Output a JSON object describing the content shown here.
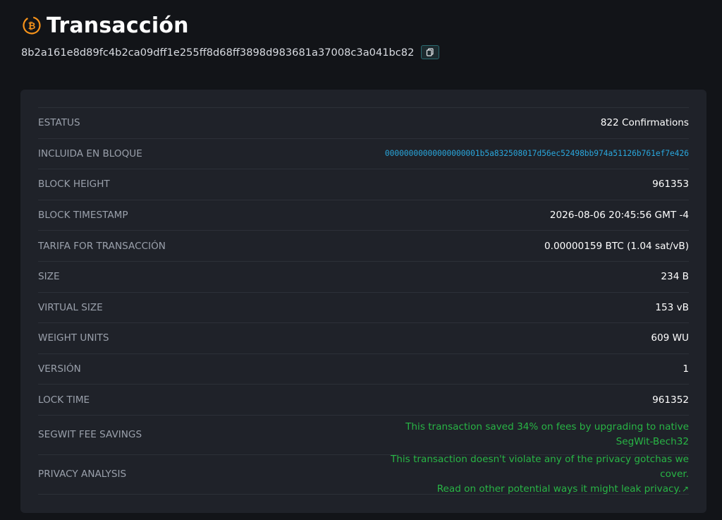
{
  "header": {
    "title": "Transacción",
    "txid": "8b2a161e8d89fc4b2ca09dff1e255ff8d68ff3898d983681a37008c3a041bc82"
  },
  "colors": {
    "background": "#121418",
    "card": "#1f2229",
    "bitcoin_orange": "#f7931a",
    "link_blue": "#2aa7dd",
    "green_text": "#28b545"
  },
  "icons": {
    "title": "bitcoin-icon",
    "copy": "copy-icon",
    "external": "external-link-icon"
  },
  "details": {
    "status": {
      "label": "ESTATUS",
      "value": "822 Confirmations"
    },
    "block": {
      "label": "INCLUIDA EN BLOQUE",
      "value": "00000000000000000001b5a832508017d56ec52498bb974a51126b761ef7e426"
    },
    "height": {
      "label": "BLOCK HEIGHT",
      "value": "961353"
    },
    "timestamp": {
      "label": "BLOCK TIMESTAMP",
      "value": "2026-08-06 20:45:56 GMT -4"
    },
    "fee": {
      "label": "TARIFA FOR TRANSACCIÓN",
      "value": "0.00000159 BTC (1.04 sat/vB)"
    },
    "size": {
      "label": "SIZE",
      "value": "234 B"
    },
    "vsize": {
      "label": "VIRTUAL SIZE",
      "value": "153 vB"
    },
    "weight": {
      "label": "WEIGHT UNITS",
      "value": "609 WU"
    },
    "version": {
      "label": "VERSIÓN",
      "value": "1"
    },
    "locktime": {
      "label": "LOCK TIME",
      "value": "961352"
    },
    "segwit": {
      "label": "SEGWIT FEE SAVINGS",
      "value": "This transaction saved 34% on fees by upgrading to native SegWit-Bech32"
    },
    "privacy": {
      "label": "PRIVACY ANALYSIS",
      "line1": "This transaction doesn't violate any of the privacy gotchas we cover.",
      "line2": "Read on other potential ways it might leak privacy."
    }
  }
}
